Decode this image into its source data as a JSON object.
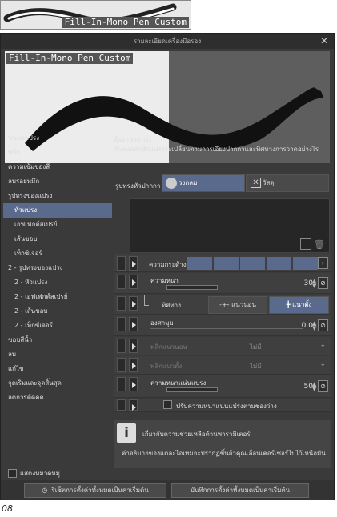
{
  "thumbnail": {
    "label": "Fill-In-Mono Pen Custom"
  },
  "dialog": {
    "title": "รายละเอียดเครื่องมือรอง",
    "close": "✕",
    "preview_label": "Fill-In-Mono Pen Custom",
    "sidebar": [
      {
        "label": "ขนาดแปรง",
        "sub": false,
        "sel": false
      },
      {
        "label": "หมึก",
        "sub": false,
        "sel": false
      },
      {
        "label": "ความเข้มของสี",
        "sub": false,
        "sel": false
      },
      {
        "label": "ลบรอยหมึก",
        "sub": false,
        "sel": false
      },
      {
        "label": "รูปทรงของแปรง",
        "sub": false,
        "sel": false
      },
      {
        "label": "หัวแปรง",
        "sub": true,
        "sel": true
      },
      {
        "label": "เอฟเฟกต์สเปรย์",
        "sub": true,
        "sel": false
      },
      {
        "label": "เส้นขอบ",
        "sub": true,
        "sel": false
      },
      {
        "label": "เท็กซ์เจอร์",
        "sub": true,
        "sel": false
      },
      {
        "label": "2 - รูปทรงของแปรง",
        "sub": false,
        "sel": false
      },
      {
        "label": "2 - หัวแปรง",
        "sub": true,
        "sel": false
      },
      {
        "label": "2 - เอฟเฟกต์สเปรย์",
        "sub": true,
        "sel": false
      },
      {
        "label": "2 - เส้นขอบ",
        "sub": true,
        "sel": false
      },
      {
        "label": "2 - เท็กซ์เจอร์",
        "sub": true,
        "sel": false
      },
      {
        "label": "ขอบสีน้ำ",
        "sub": false,
        "sel": false
      },
      {
        "label": "ลบ",
        "sub": false,
        "sel": false
      },
      {
        "label": "แก้ไข",
        "sub": false,
        "sel": false
      },
      {
        "label": "จุดเริ่มและจุดสิ้นสุด",
        "sub": false,
        "sel": false
      },
      {
        "label": "ลดการตัดคด",
        "sub": false,
        "sel": false
      }
    ],
    "show_all": "แสดงหมวดหมู่",
    "main": {
      "heading": "ตั้งค่าหัวแปรง",
      "desc": "กำหนดค่าหัวแปรงจะเปลี่ยนตามการเอียงปากกาและทิศทางการวาดอย่างไร",
      "tip_shape_label": "รูปทรงหัวปากกา",
      "tip_circle": "วงกลม",
      "tip_material": "วัสดุ",
      "hardness_label": "ความกระด้าง",
      "thickness_label": "ความหนา",
      "thickness_value": "30",
      "direction_label": "ทิศทาง",
      "dir_horizontal": "แนวนอน",
      "dir_vertical": "แนวตั้ง",
      "angle_label": "องศามุม",
      "angle_value": "0.0",
      "flip_h_label": "พลิกแนวนอน",
      "flip_h_value": "ไม่มี",
      "flip_v_label": "พลิกแนวตั้ง",
      "flip_v_value": "ไม่มี",
      "density_label": "ความหนาแน่นแปรง",
      "density_value": "50",
      "density_check": "ปรับความหนาแน่นแปรงตามช่องว่าง"
    },
    "info": {
      "title": "เกี่ยวกับความช่วยเหลือด้านพารามิเตอร์",
      "text": "คำอธิบายของแต่ละไอเทมจะปรากฏขึ้นถ้าคุณเลื่อนเคอร์เซอร์ไปไว้เหนือมัน"
    },
    "bottom": {
      "reset": "รีเซ็ตการตั้งค่าทั้งหมดเป็นค่าเริ่มต้น",
      "save": "บันทึกการตั้งค่าทั้งหมดเป็นค่าเริ่มต้น"
    }
  },
  "page_number": "08"
}
